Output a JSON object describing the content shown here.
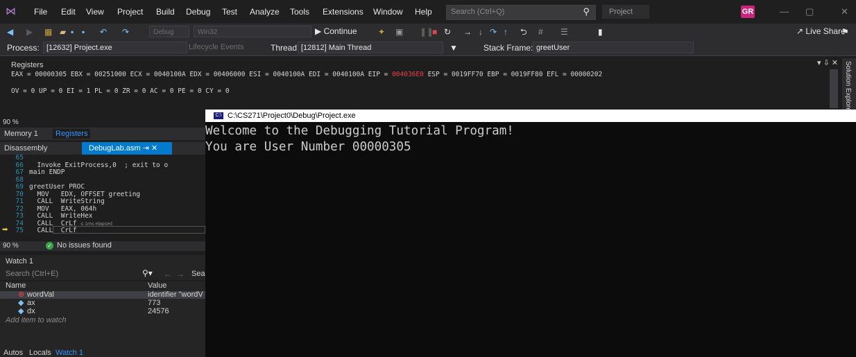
{
  "menubar": {
    "items": [
      "File",
      "Edit",
      "View",
      "Project",
      "Build",
      "Debug",
      "Test",
      "Analyze",
      "Tools",
      "Extensions",
      "Window",
      "Help"
    ],
    "search_placeholder": "Search (Ctrl+Q)",
    "project": "Project",
    "avatar": "GR"
  },
  "toolbar": {
    "config": "Debug",
    "platform": "Win32",
    "continue": "▶ Continue",
    "live_share": "Live Share"
  },
  "location": {
    "process_label": "Process:",
    "process": "[12632] Project.exe",
    "lifecycle": "Lifecycle Events",
    "thread_label": "Thread:",
    "thread": "[12812] Main Thread",
    "frame_label": "Stack Frame:",
    "frame": "greetUser"
  },
  "registers": {
    "title": "Registers",
    "line1_a": "EAX = 00000305 EBX = 00251000 ECX = 0040100A EDX = 00406000 ESI = 0040100A EDI = 0040100A EIP = ",
    "eip": "004036E0",
    "line1_b": " ESP = 0019FF70 EBP = 0019FF80 EFL = 00000202",
    "line2": "OV = 0 UP = 0 EI = 1 PL = 0 ZR = 0 AC = 0 PE = 0 CY = 0"
  },
  "side": {
    "solution_explorer": "Solution Explorer",
    "zoom": "90 %",
    "memory_tab": "Memory 1",
    "registers_tab": "Registers",
    "disassembly_tab": "Disassembly",
    "debuglab_tab": "DebugLab.asm",
    "issues": "No issues found"
  },
  "code": [
    {
      "n": "65",
      "t": ""
    },
    {
      "n": "66",
      "t": "  Invoke ExitProcess,0  ; exit to o"
    },
    {
      "n": "67",
      "t": "main ENDP"
    },
    {
      "n": "68",
      "t": ""
    },
    {
      "n": "69",
      "t": "greetUser PROC"
    },
    {
      "n": "70",
      "t": "  MOV   EDX, OFFSET greeting"
    },
    {
      "n": "71",
      "t": "  CALL  WriteString"
    },
    {
      "n": "72",
      "t": "  MOV   EAX, 064h"
    },
    {
      "n": "73",
      "t": "  CALL  WriteHex"
    },
    {
      "n": "74",
      "t": "  CALL  CrLf"
    },
    {
      "n": "75",
      "t": "  CALL  CrLf"
    }
  ],
  "elapsed": "≤ 1ms elapsed",
  "watch": {
    "title": "Watch 1",
    "search": "Search (Ctrl+E)",
    "search_depth": "Sea",
    "col_name": "Name",
    "col_value": "Value",
    "rows": [
      {
        "name": "wordVal",
        "value": "identifier \"wordV"
      },
      {
        "name": "ax",
        "value": "773"
      },
      {
        "name": "dx",
        "value": "24576"
      }
    ],
    "add": "Add item to watch"
  },
  "bottom_tabs": [
    "Autos",
    "Locals",
    "Watch 1"
  ],
  "console": {
    "title": "C:\\CS271\\Project0\\Debug\\Project.exe",
    "icon": "C:\\",
    "lines": [
      "Welcome to the Debugging Tutorial Program!",
      "You are User Number 00000305"
    ]
  },
  "colors": {
    "accent": "#007acc",
    "eip_changed": "#e8414a",
    "console_bg": "#0c0c0c"
  }
}
